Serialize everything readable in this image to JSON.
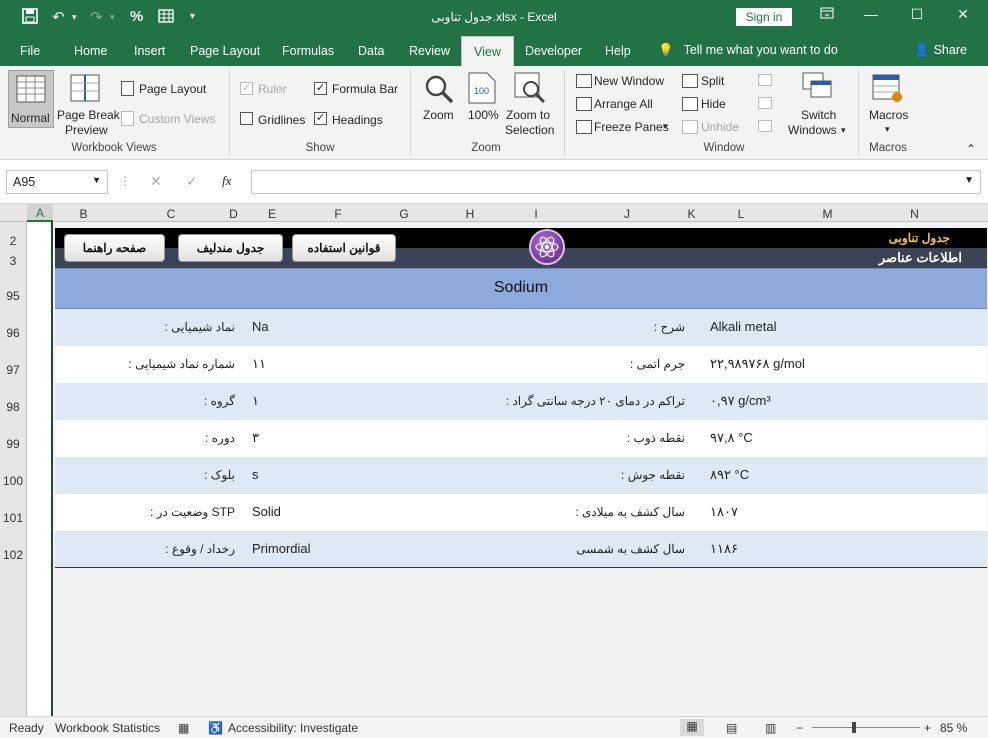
{
  "app": {
    "window_title": "جدول تناوبی.xlsx  -  Excel",
    "sign_in": "Sign in",
    "quick_access": {
      "zoom_label": "%"
    },
    "window_controls": [
      "restore-ribbon",
      "minimize",
      "maximize",
      "close"
    ]
  },
  "tabs": [
    {
      "label": "File"
    },
    {
      "label": "Home"
    },
    {
      "label": "Insert"
    },
    {
      "label": "Page Layout"
    },
    {
      "label": "Formulas"
    },
    {
      "label": "Data"
    },
    {
      "label": "Review"
    },
    {
      "label": "View"
    },
    {
      "label": "Developer"
    },
    {
      "label": "Help"
    }
  ],
  "tell_me": "Tell me what you want to do",
  "share": "Share",
  "ribbon": {
    "workbook_views": {
      "group": "Workbook Views",
      "normal": "Normal",
      "page_break_1": "Page Break",
      "page_break_2": "Preview",
      "page_layout": "Page Layout",
      "custom_views": "Custom Views"
    },
    "show": {
      "group": "Show",
      "ruler": "Ruler",
      "gridlines": "Gridlines",
      "formula_bar": "Formula Bar",
      "headings": "Headings"
    },
    "zoom": {
      "group": "Zoom",
      "zoom": "Zoom",
      "hundred": "100%",
      "zoom_sel_1": "Zoom to",
      "zoom_sel_2": "Selection"
    },
    "window": {
      "group": "Window",
      "new_window": "New Window",
      "arrange_all": "Arrange All",
      "freeze_panes": "Freeze Panes",
      "split": "Split",
      "hide": "Hide",
      "unhide": "Unhide",
      "switch_1": "Switch",
      "switch_2": "Windows"
    },
    "macros": {
      "group": "Macros",
      "macros": "Macros"
    }
  },
  "formula_bar": {
    "name_box": "A95",
    "fx": "fx",
    "value": ""
  },
  "columns": [
    "A",
    "B",
    "C",
    "D",
    "E",
    "F",
    "G",
    "H",
    "I",
    "J",
    "K",
    "L",
    "M",
    "N"
  ],
  "rows": [
    "2",
    "3",
    "95",
    "96",
    "97",
    "98",
    "99",
    "100",
    "101",
    "102"
  ],
  "sheet": {
    "brand_title": "جدول تناوبی",
    "brand_sub": "اطلاعات عناصر",
    "buttons": {
      "rules": "قوانین استفاده",
      "mendeleev": "جدول مندلیف",
      "help": "صفحه راهنما"
    },
    "element_name": "Sodium",
    "rows": [
      {
        "l_label": ": نماد شیمیایی",
        "l_value": "Na",
        "r_label": ": شرح",
        "r_value": "Alkali metal"
      },
      {
        "l_label": ": شماره نماد شیمیایی",
        "l_value": "۱۱",
        "r_label": ": جرم اتمی",
        "r_value": "۲۲,۹۸۹۷۶۸ g/mol"
      },
      {
        "l_label": ": گروه",
        "l_value": "۱",
        "r_label": ": تراکم در دمای ۲۰ درجه سانتی گراد",
        "r_value": "۰,۹۷ g/cm³"
      },
      {
        "l_label": ": دوره",
        "l_value": "۳",
        "r_label": ": نقطه ذوب",
        "r_value": "۹۷,۸ °C"
      },
      {
        "l_label": ": بلوک",
        "l_value": "s",
        "r_label": ": نقطه جوش",
        "r_value": "۸۹۲ °C"
      },
      {
        "l_label": ": وضعیت در STP",
        "l_value": "Solid",
        "r_label": ": سال کشف به میلادی",
        "r_value": "۱۸۰۷"
      },
      {
        "l_label": ": رخداد / وقوع",
        "l_value": "Primordial",
        "r_label": "سال کشف به شمسی",
        "r_value": "۱۱۸۶"
      }
    ]
  },
  "status": {
    "ready": "Ready",
    "workbook_stats": "Workbook Statistics",
    "accessibility": "Accessibility: Investigate",
    "zoom": "85 %"
  },
  "colors": {
    "excel_green": "#217346",
    "element_bar": "#8ea9db",
    "row_alt": "#dde9f5",
    "brand_gold": "#f5c24b"
  }
}
